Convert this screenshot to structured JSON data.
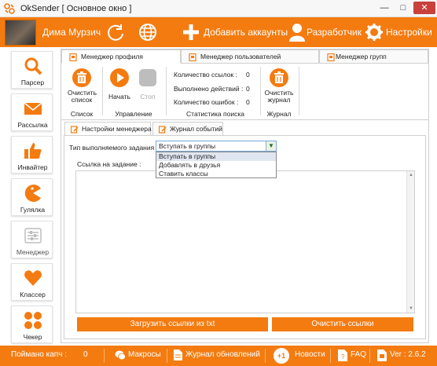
{
  "window": {
    "title": "OkSender [ Основное окно ]",
    "controls": {
      "minimize": "—",
      "maximize": "□",
      "close": "✕"
    }
  },
  "header": {
    "user_name": "Дима Мурзич",
    "add_accounts_label": "Добавить аккаунты",
    "developer_label": "Разработчик",
    "settings_label": "Настройки"
  },
  "sidebar": {
    "items": [
      {
        "label": "Парсер",
        "icon": "search-icon"
      },
      {
        "label": "Рассылка",
        "icon": "envelope-icon"
      },
      {
        "label": "Инвайтер",
        "icon": "thumbs-up-icon"
      },
      {
        "label": "Гулялка",
        "icon": "pacman-icon"
      },
      {
        "label": "Менеджер",
        "icon": "sliders-icon",
        "disabled": true
      },
      {
        "label": "Классер",
        "icon": "heart-icon"
      },
      {
        "label": "Чекер",
        "icon": "grid-icon"
      }
    ]
  },
  "main_tabs": [
    "Менеджер профиля",
    "Менеджер пользователей",
    "Менеджер групп"
  ],
  "ribbon": {
    "clear_list_label": "Очистить список",
    "start_label": "Начать",
    "stop_label": "Стоп",
    "stats": [
      {
        "label": "Количество ссылок :",
        "value": "0"
      },
      {
        "label": "Выполнено действий :",
        "value": "0"
      },
      {
        "label": "Количество ошибок :",
        "value": "0"
      }
    ],
    "clear_log_label": "Очистить журнал",
    "groups": {
      "list": "Список",
      "control": "Управление",
      "stats": "Статистика поиска",
      "log": "Журнал"
    }
  },
  "sub_tabs": [
    "Настройки менеджера",
    "Журнал событий"
  ],
  "settings": {
    "task_type_label": "Тип выполняемого задания :",
    "task_type_value": "Вступать в группы",
    "task_type_options": [
      "Вступать в группы",
      "Добавлять в друзья",
      "Ставить классы"
    ],
    "link_label": "Ссылка на задание :",
    "load_button": "Загрузить ссылки из txt",
    "clear_links_button": "Очистить ссылки"
  },
  "statusbar": {
    "captcha_label": "Поймано капч :",
    "captcha_value": "0",
    "macros_label": "Макросы",
    "updates_label": "Журнал обновлений",
    "news_badge": "+1",
    "news_label": "Новости",
    "faq_label": "FAQ",
    "version": "Ver : 2.6.2"
  },
  "colors": {
    "accent": "#f47b10",
    "stop_disabled": "#bdbdbd"
  }
}
